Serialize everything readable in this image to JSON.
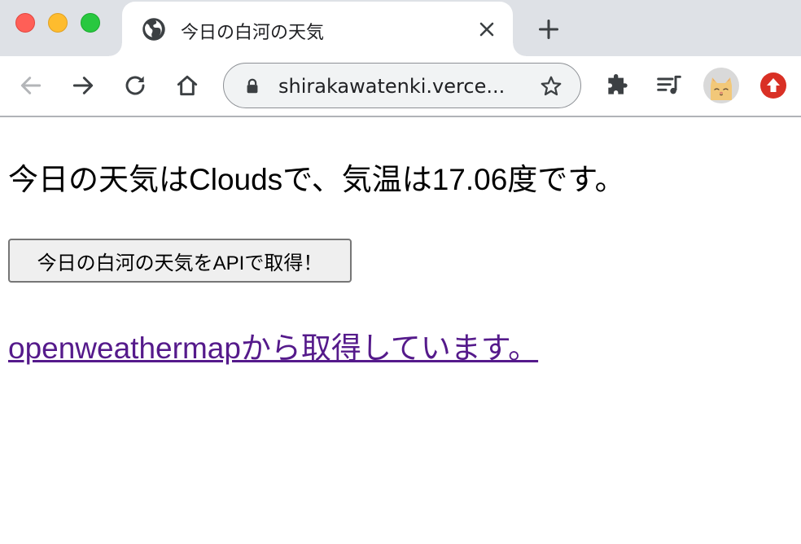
{
  "browser": {
    "tab": {
      "title": "今日の白河の天気",
      "favicon_icon": "globe-icon",
      "close_icon": "close-icon"
    },
    "new_tab_icon": "plus-icon",
    "toolbar": {
      "back_icon": "back-arrow-icon",
      "forward_icon": "forward-arrow-icon",
      "reload_icon": "reload-icon",
      "home_icon": "home-icon",
      "address": {
        "lock_icon": "lock-icon",
        "url": "shirakawatenki.verce...",
        "bookmark_icon": "star-icon"
      },
      "extensions_icon": "puzzle-icon",
      "media_icon": "playlist-icon",
      "profile_icon": "cat-avatar-icon",
      "update_icon": "arrow-up-icon"
    },
    "colors": {
      "tabstrip_bg": "#dee1e6",
      "update_red": "#d93025",
      "visited_link": "#551a8b"
    }
  },
  "page": {
    "weather_text": "今日の天気はCloudsで、気温は17.06度です。",
    "fetch_button_label": "今日の白河の天気をAPIで取得！",
    "source_link_text": "openweathermapから取得しています。"
  }
}
